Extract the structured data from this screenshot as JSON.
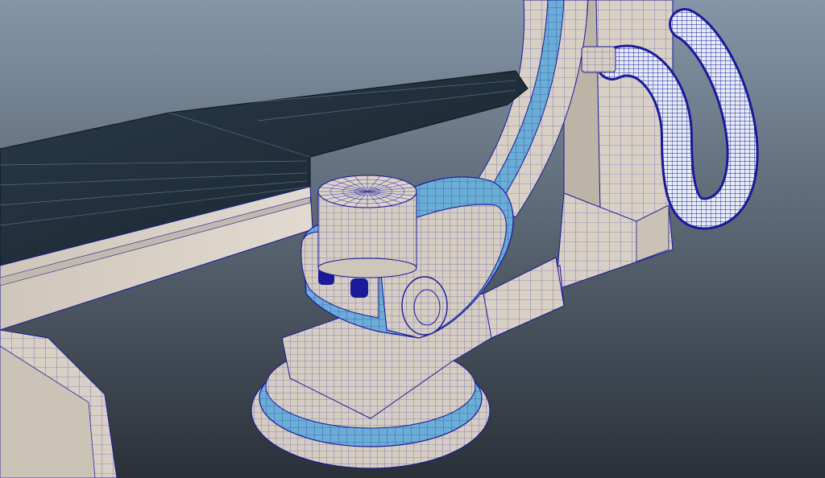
{
  "viewport": {
    "background_top": "#8596a8",
    "background_bottom": "#2a3038",
    "wire_color": "#1a1a9a",
    "surface_light": "#d8cfc4",
    "surface_blue": "#6aaed6",
    "surface_dark": "#1c2a36"
  },
  "scene": {
    "objects": [
      {
        "name": "patient-table",
        "icon": "table-model"
      },
      {
        "name": "c-arm",
        "icon": "c-arm-model"
      },
      {
        "name": "flexible-hose",
        "icon": "hose-model"
      },
      {
        "name": "detector-head",
        "icon": "detector-model"
      },
      {
        "name": "rotating-base",
        "icon": "base-model"
      }
    ]
  }
}
